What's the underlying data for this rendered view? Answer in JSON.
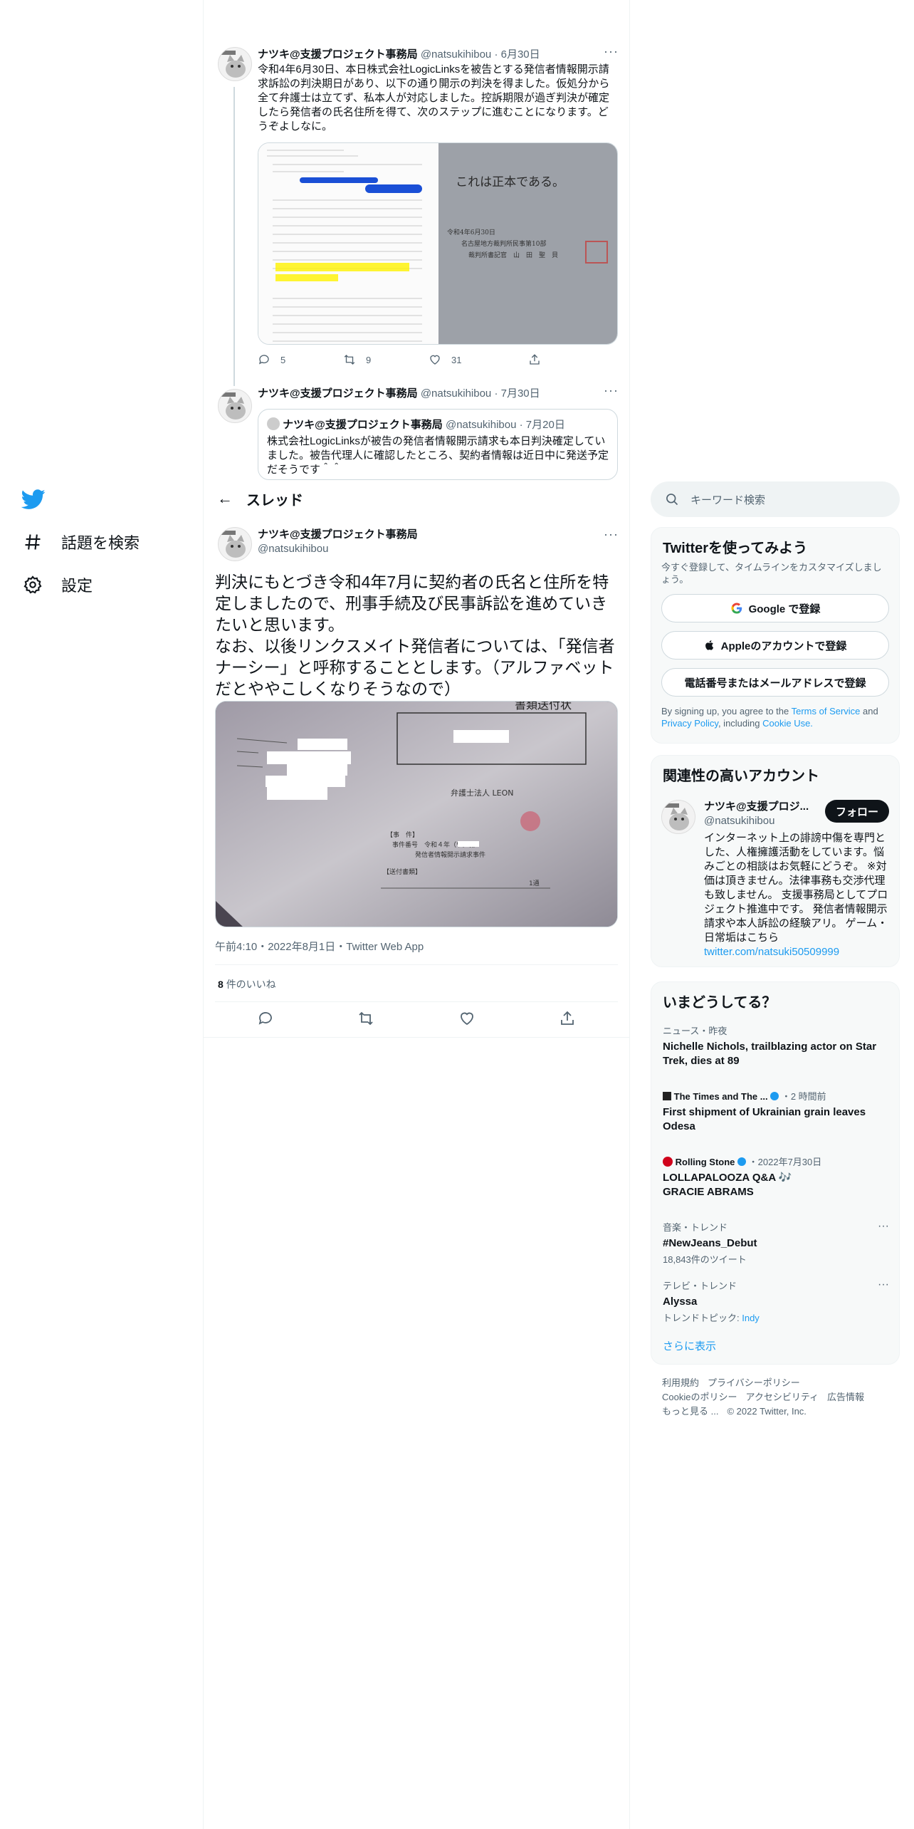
{
  "nav": {
    "explore_label": "話題を検索",
    "settings_label": "設定"
  },
  "tweet1": {
    "name": "ナツキ@支援プロジェクト事務局",
    "handle": "@natsukihibou",
    "date": "6月30日",
    "text": "令和4年6月30日、本日株式会社LogicLinksを被告とする発信者情報開示請求訴訟の判決期日があり、以下の通り開示の判決を得ました。仮処分から全て弁護士は立てず、私本人が対応しました。控訴期限が過ぎ判決が確定したら発信者の氏名住所を得て、次のステップに進むことになります。どうぞよしなに。",
    "replies": "5",
    "retweets": "9",
    "likes": "31",
    "image_text_right": "これは正本である。",
    "image_text_date": "令和4年6月30日",
    "image_text_court": "名古屋地方裁判所民事第10部",
    "image_text_clerk": "裁判所書記官　山　田　聖　貝"
  },
  "tweet2": {
    "name": "ナツキ@支援プロジェクト事務局",
    "handle": "@natsukihibou",
    "date": "7月30日",
    "quote_name": "ナツキ@支援プロジェクト事務局",
    "quote_handle": "@natsukihibou",
    "quote_date": "7月20日",
    "quote_text": "株式会社LogicLinksが被告の発信者情報開示請求も本日判決確定していました。被告代理人に確認したところ、契約者情報は近日中に発送予定だそうです＾＾"
  },
  "header": {
    "title": "スレッド"
  },
  "main_tweet": {
    "name": "ナツキ@支援プロジェクト事務局",
    "handle": "@natsukihibou",
    "text1": "判決にもとづき令和4年7月に契約者の氏名と住所を特定しましたので、刑事手続及び民事訴訟を進めていきたいと思います。",
    "text2": "なお、以後リンクスメイト発信者については、「発信者ナーシー」と呼称することとします。（アルファベットだとややこしくなりそうなので）",
    "image_title": "書類送付状",
    "image_firm": "弁護士法人 LEON",
    "image_case_label": "【事　件】",
    "image_case": "事件番号　令和４年（ワ）第",
    "image_case_name": "発信者情報開示請求事件",
    "image_docs_label": "【送付書類】",
    "image_docs_count": "1通",
    "timestamp": "午前4:10・2022年8月1日・Twitter Web App",
    "likes_count": "8",
    "likes_label": "件のいいね"
  },
  "search": {
    "placeholder": "キーワード検索"
  },
  "signup": {
    "title": "Twitterを使ってみよう",
    "subtitle": "今すぐ登録して、タイムラインをカスタマイズしましょう。",
    "google": "Google で登録",
    "apple": "Appleのアカウントで登録",
    "phone": "電話番号またはメールアドレスで登録",
    "terms_prefix": "By signing up, you agree to the ",
    "terms_link": "Terms of Service",
    "terms_and": " and ",
    "privacy_link": "Privacy Policy",
    "terms_including": ", including ",
    "cookie_link": "Cookie Use."
  },
  "related": {
    "title": "関連性の高いアカウント",
    "name": "ナツキ@支援プロジ...",
    "handle": "@natsukihibou",
    "follow": "フォロー",
    "bio": "インターネット上の誹謗中傷を専門とした、人権擁護活動をしています。悩みごとの相談はお気軽にどうぞ。 ※対価は頂きません。法律事務も交渉代理も致しません。 支援事務局としてプロジェクト推進中です。 発信者情報開示請求や本人訴訟の経験アリ。 ゲーム・日常垢はこちら",
    "bio_link": "twitter.com/natsuki50509999"
  },
  "trends": {
    "title": "いまどうしてる？",
    "items": [
      {
        "meta": "ニュース・昨夜",
        "text": "Nichelle Nichols, trailblazing actor on Star Trek, dies at 89"
      },
      {
        "source": "The Times and The ...",
        "meta": "・2 時間前",
        "text": "First shipment of Ukrainian grain leaves Odesa"
      },
      {
        "source": "Rolling Stone",
        "meta": "・2022年7月30日",
        "text": "LOLLAPALOOZA Q&A 🎶 GRACIE ABRAMS"
      },
      {
        "meta": "音楽・トレンド",
        "text": "#NewJeans_Debut",
        "sub": "18,843件のツイート"
      },
      {
        "meta": "テレビ・トレンド",
        "text": "Alyssa",
        "sub_prefix": "トレンドトピック: ",
        "sub_link": "Indy"
      }
    ],
    "show_more": "さらに表示"
  },
  "footer": {
    "terms": "利用規約",
    "privacy": "プライバシーポリシー",
    "cookie": "Cookieのポリシー",
    "accessibility": "アクセシビリティ",
    "ads": "広告情報",
    "more": "もっと見る ...",
    "copyright": "© 2022 Twitter, Inc."
  },
  "colors": {
    "accent": "#1d9bf0",
    "text": "#0f1419",
    "muted": "#536471",
    "panel_bg": "#f7f9f9"
  }
}
